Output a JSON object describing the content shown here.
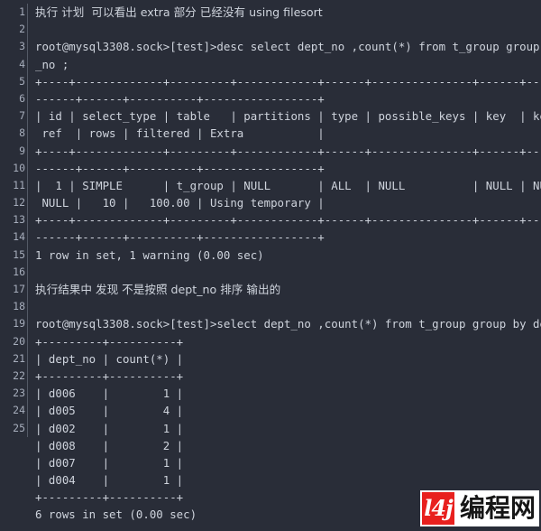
{
  "editor": {
    "background_color": "#292d38",
    "text_color": "#cfd4dd",
    "gutter_color": "#a6adbb",
    "divider_color": "#545a66",
    "last_numbered_line": 25,
    "lines": [
      {
        "num": "1",
        "text": "执行 计划  可以看出 extra 部分 已经没有 using filesort",
        "cjk": true
      },
      {
        "num": "2",
        "text": "",
        "cjk": false
      },
      {
        "num": "3",
        "text": "root@mysql3308.sock>[test]>desc select dept_no ,count(*) from t_group group by dept",
        "cjk": false
      },
      {
        "num": "4",
        "text": "_no ;",
        "cjk": false
      },
      {
        "num": "5",
        "text": "+----+-------------+---------+------------+------+---------------+------+---------+",
        "cjk": false
      },
      {
        "num": "6",
        "text": "------+------+----------+-----------------+",
        "cjk": false
      },
      {
        "num": "7",
        "text": "| id | select_type | table   | partitions | type | possible_keys | key  | key_len |",
        "cjk": false
      },
      {
        "num": "8",
        "text": " ref  | rows | filtered | Extra           |",
        "cjk": false
      },
      {
        "num": "9",
        "text": "+----+-------------+---------+------------+------+---------------+------+---------+",
        "cjk": false
      },
      {
        "num": "10",
        "text": "------+------+----------+-----------------+",
        "cjk": false
      },
      {
        "num": "11",
        "text": "|  1 | SIMPLE      | t_group | NULL       | ALL  | NULL          | NULL | NULL    |",
        "cjk": false
      },
      {
        "num": "12",
        "text": " NULL |   10 |   100.00 | Using temporary |",
        "cjk": false
      },
      {
        "num": "13",
        "text": "+----+-------------+---------+------------+------+---------------+------+---------+",
        "cjk": false
      },
      {
        "num": "14",
        "text": "------+------+----------+-----------------+",
        "cjk": false
      },
      {
        "num": "15",
        "text": "1 row in set, 1 warning (0.00 sec)",
        "cjk": false
      },
      {
        "num": "16",
        "text": "",
        "cjk": false
      },
      {
        "num": "17",
        "text": "执行结果中 发现 不是按照 dept_no 排序 输出的",
        "cjk": true
      },
      {
        "num": "18",
        "text": "",
        "cjk": false
      },
      {
        "num": "19",
        "text": "root@mysql3308.sock>[test]>select dept_no ,count(*) from t_group group by dept_no ;",
        "cjk": false
      },
      {
        "num": "20",
        "text": "+---------+----------+",
        "cjk": false
      },
      {
        "num": "21",
        "text": "| dept_no | count(*) |",
        "cjk": false
      },
      {
        "num": "22",
        "text": "+---------+----------+",
        "cjk": false
      },
      {
        "num": "23",
        "text": "| d006    |        1 |",
        "cjk": false
      },
      {
        "num": "24",
        "text": "| d005    |        4 |",
        "cjk": false
      },
      {
        "num": "25",
        "text": "| d002    |        1 |",
        "cjk": false
      },
      {
        "num": "",
        "text": "| d008    |        2 |",
        "cjk": false
      },
      {
        "num": "",
        "text": "| d007    |        1 |",
        "cjk": false
      },
      {
        "num": "",
        "text": "| d004    |        1 |",
        "cjk": false
      },
      {
        "num": "",
        "text": "+---------+----------+",
        "cjk": false
      },
      {
        "num": "",
        "text": "6 rows in set (0.00 sec)",
        "cjk": false
      }
    ]
  },
  "watermark": {
    "mark_text": "l4j",
    "label": "编程网",
    "mark_bg_color": "#e8201e",
    "panel_bg_color": "#ffffff",
    "label_color": "#161616"
  }
}
